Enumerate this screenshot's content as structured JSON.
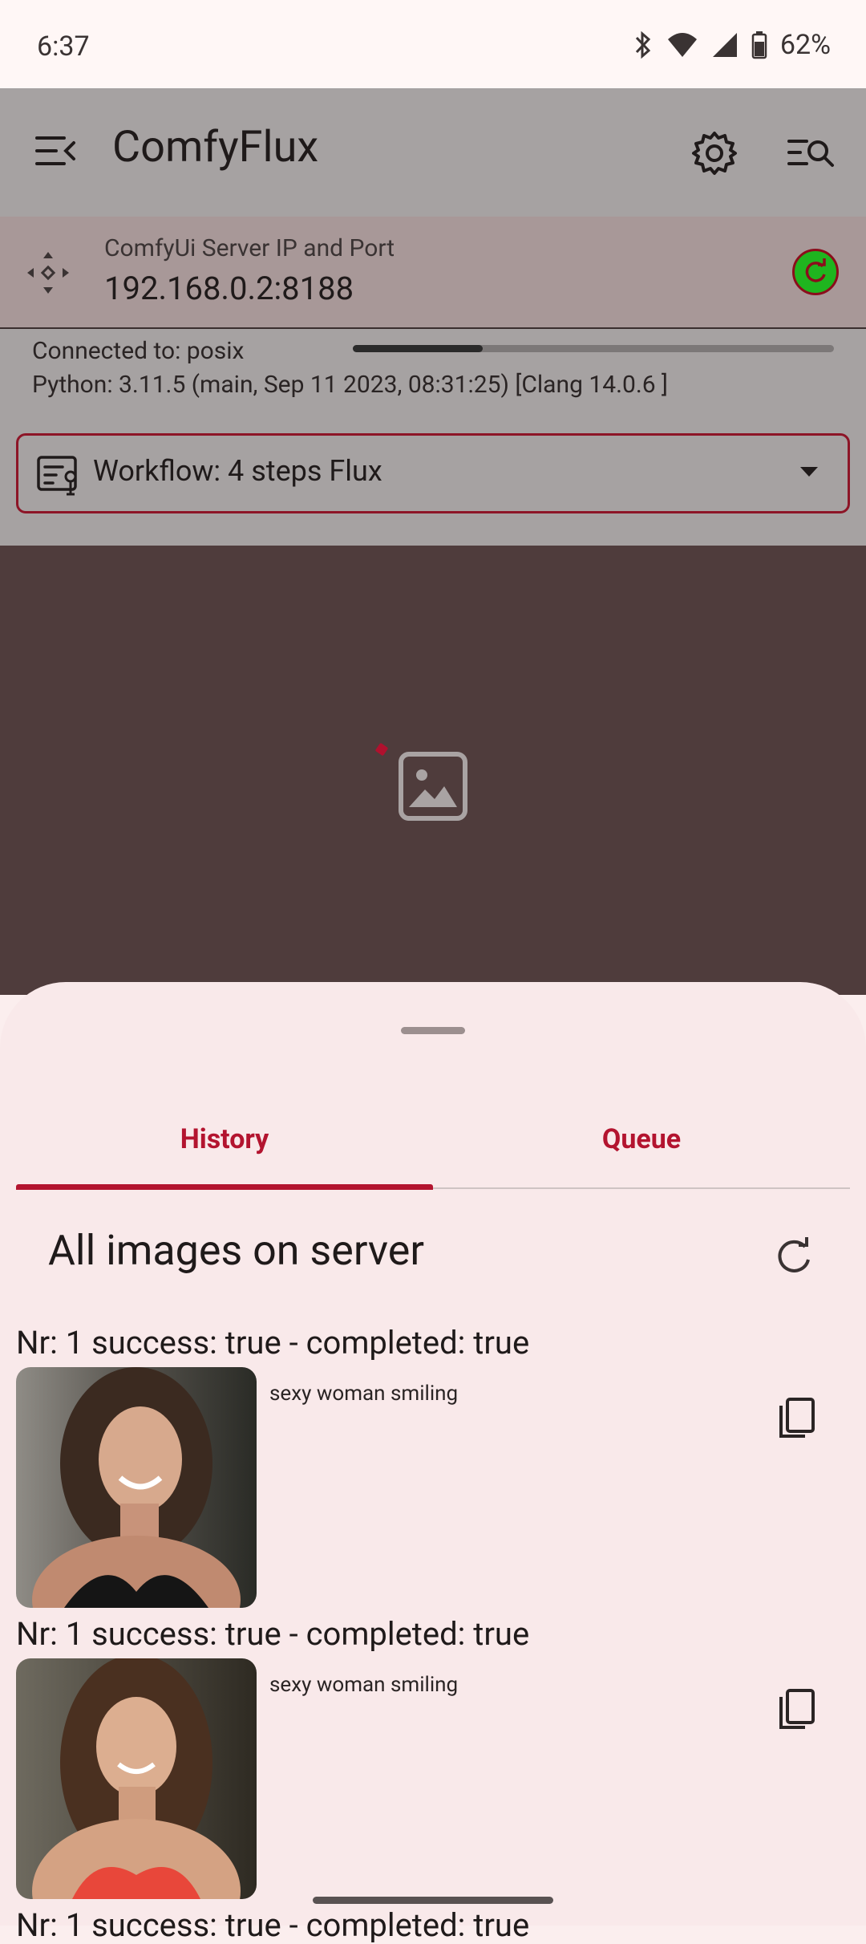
{
  "status_bar": {
    "time": "6:37",
    "battery": "62%",
    "icons": [
      "bluetooth-icon",
      "wifi-icon",
      "signal-icon",
      "battery-icon"
    ]
  },
  "app_bar": {
    "title": "ComfyFlux",
    "icons": [
      "menu-icon",
      "settings-icon",
      "search-list-icon"
    ]
  },
  "server": {
    "label": "ComfyUi Server IP and Port",
    "value": "192.168.0.2:8188",
    "status_color": "#1fb51f"
  },
  "connection": {
    "connected": "Connected to: posix",
    "python": "Python: 3.11.5 (main, Sep 11 2023, 08:31:25) [Clang 14.0.6 ]",
    "progress": 0.27
  },
  "workflow": {
    "label": "Workflow: 4 steps Flux"
  },
  "sheet": {
    "tabs": [
      "History",
      "Queue"
    ],
    "active_tab": "History",
    "section_title": "All images on server",
    "entries": [
      {
        "title": "Nr: 1 success: true - completed: true",
        "prompt": "sexy woman smiling"
      },
      {
        "title": "Nr: 1 success: true - completed: true",
        "prompt": "sexy woman smiling"
      },
      {
        "title": "Nr: 1 success: true - completed: true",
        "prompt": ""
      }
    ]
  },
  "colors": {
    "accent": "#b3142f",
    "sheet_bg": "#f9e9ea",
    "scrim": "#a6a2a2"
  }
}
